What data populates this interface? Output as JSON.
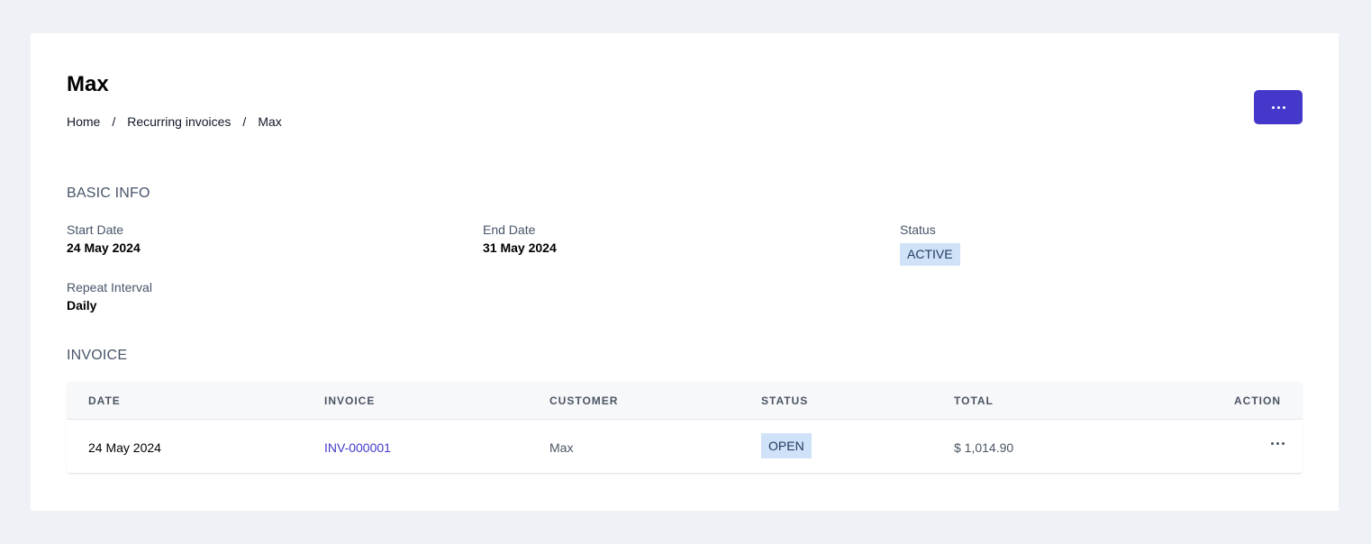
{
  "header": {
    "title": "Max",
    "breadcrumb": [
      "Home",
      "Recurring invoices",
      "Max"
    ],
    "breadcrumb_separator": "/",
    "more_icon": "ellipsis-horizontal-icon"
  },
  "basic_info": {
    "section_title": "BASIC INFO",
    "start_date": {
      "label": "Start Date",
      "value": "24 May 2024"
    },
    "end_date": {
      "label": "End Date",
      "value": "31 May 2024"
    },
    "status": {
      "label": "Status",
      "value": "ACTIVE"
    },
    "repeat_interval": {
      "label": "Repeat Interval",
      "value": "Daily"
    }
  },
  "invoice": {
    "section_title": "INVOICE",
    "columns": [
      "DATE",
      "INVOICE",
      "CUSTOMER",
      "STATUS",
      "TOTAL",
      "ACTION"
    ],
    "rows": [
      {
        "date": "24 May 2024",
        "invoice": "INV-000001",
        "customer": "Max",
        "status": "OPEN",
        "total": "$ 1,014.90",
        "action_icon": "ellipsis-horizontal-icon"
      }
    ]
  },
  "colors": {
    "background": "#eef2f6",
    "accent": "#4338ca",
    "badge_bg": "#cfe2f7",
    "badge_text": "#1e3a5f"
  }
}
